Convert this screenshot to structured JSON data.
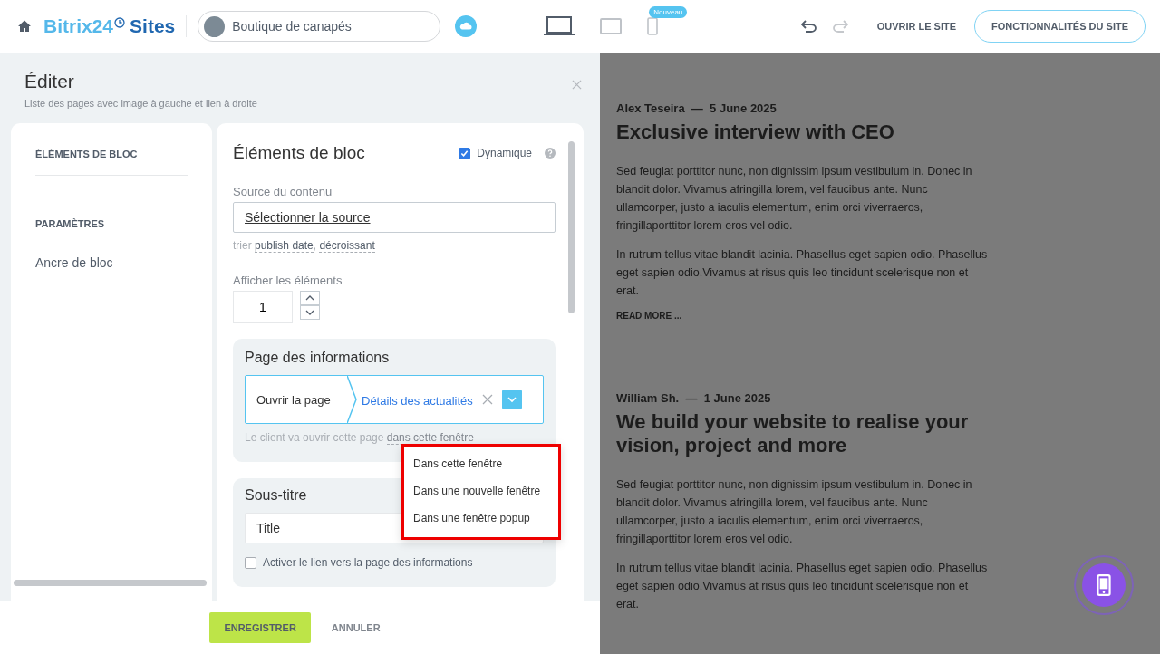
{
  "topbar": {
    "logo": {
      "brand": "Bitrix24",
      "product": "Sites"
    },
    "site_selector": {
      "name": "Boutique de canapés"
    },
    "devices": [
      {
        "kind": "desktop",
        "selected": true
      },
      {
        "kind": "tablet",
        "selected": false
      },
      {
        "kind": "mobile",
        "selected": false,
        "badge": "Nouveau"
      }
    ],
    "undo": {
      "disabled": false
    },
    "redo": {
      "disabled": true
    },
    "open_site": "OUVRIR LE SITE",
    "site_features": "FONCTIONNALITÉS DU SITE"
  },
  "editor": {
    "title": "Éditer",
    "subtitle": "Liste des pages avec image à gauche et lien à droite",
    "nav": [
      {
        "heading": "ÉLÉMENTS DE BLOC"
      },
      {
        "heading": "PARAMÈTRES",
        "items": [
          "Ancre de bloc"
        ]
      }
    ],
    "section_title": "Éléments de bloc",
    "dynamic": {
      "label": "Dynamique",
      "checked": true
    },
    "source": {
      "label": "Source du contenu",
      "value": "Sélectionner la source"
    },
    "sort": {
      "prefix": "trier",
      "field": "publish date",
      "separator": ",",
      "order": "décroissant"
    },
    "count": {
      "label": "Afficher les éléments",
      "value": "1"
    },
    "info_page": {
      "title": "Page des informations",
      "action": "Ouvrir la page",
      "target": "Détails des actualités",
      "hint": "Le client va ouvrir cette page",
      "hint_link": "dans cette fenêtre"
    },
    "subtitle_section": {
      "title": "Sous-titre",
      "value": "Title",
      "link_label": "Activer le lien vers la page des informations",
      "link_checked": false
    },
    "dropdown": [
      "Dans cette fenêtre",
      "Dans une nouvelle fenêtre",
      "Dans une fenêtre popup"
    ],
    "save": "ENREGISTRER",
    "cancel": "ANNULER"
  },
  "preview": {
    "posts": [
      {
        "meta": "Alex Teseira  —  5 June 2025",
        "title": "Exclusive interview with CEO",
        "paragraphs": [
          "Sed feugiat porttitor nunc, non dignissim ipsum vestibulum in. Donec in blandit dolor. Vivamus afringilla lorem, vel faucibus ante. Nunc ullamcorper, justo a iaculis elementum, enim orci viverraeros, fringillaporttitor lorem eros vel odio.",
          "In rutrum tellus vitae blandit lacinia. Phasellus eget sapien odio. Phasellus eget sapien odio.Vivamus at risus quis leo tincidunt scelerisque non et erat."
        ],
        "read_more": "READ MORE ..."
      },
      {
        "meta": "William Sh.  —  1 June 2025",
        "title": "We build your website to realise your vision, project and more",
        "paragraphs": [
          "Sed feugiat porttitor nunc, non dignissim ipsum vestibulum in. Donec in blandit dolor. Vivamus afringilla lorem, vel faucibus ante. Nunc ullamcorper, justo a iaculis elementum, enim orci viverraeros, fringillaporttitor lorem eros vel odio.",
          "In rutrum tellus vitae blandit lacinia. Phasellus eget sapien odio. Phasellus eget sapien odio.Vivamus at risus quis leo tincidunt scelerisque non et erat."
        ]
      }
    ]
  }
}
